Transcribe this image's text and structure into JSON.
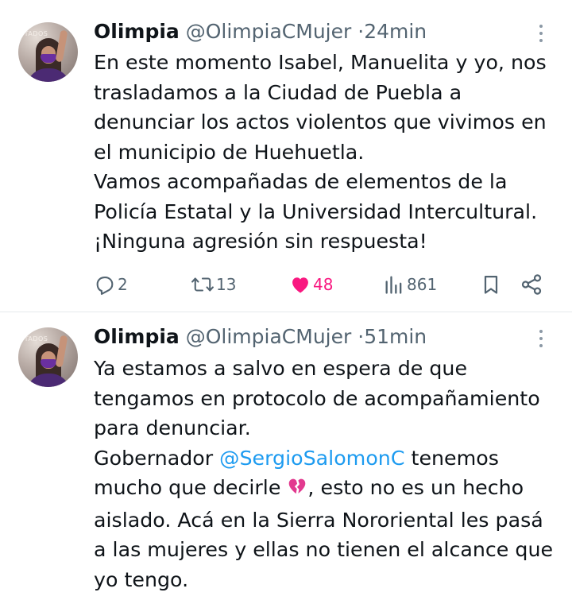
{
  "tweets": [
    {
      "display_name": "Olimpia",
      "handle": "@OlimpiaCMujer",
      "dot": "·",
      "time": "24min",
      "avatar_sign": "STADOS",
      "lines": [
        "En este momento Isabel, Manuelita y yo, nos",
        "trasladamos a la Ciudad de Puebla a",
        "denunciar los actos violentos que vivimos en",
        "el municipio de Huehuetla.",
        "Vamos acompañadas de elementos de la",
        "Policía Estatal y la Universidad Intercultural.",
        "¡Ninguna agresión sin respuesta!"
      ],
      "actions": {
        "replies": "2",
        "reposts": "13",
        "likes": "48",
        "views": "861"
      },
      "icons": {
        "reply": "reply-icon",
        "repost": "repost-icon",
        "like": "heart-filled-icon",
        "views": "views-icon",
        "bookmark": "bookmark-icon",
        "share": "share-icon",
        "more": "more-vertical-icon"
      }
    },
    {
      "display_name": "Olimpia",
      "handle": "@OlimpiaCMujer",
      "dot": "·",
      "time": "51min",
      "avatar_sign": "STADOS",
      "lines": [
        "Ya estamos a salvo en espera de que",
        "tengamos en protocolo de acompañamiento",
        "para denunciar."
      ],
      "line4": {
        "prefix": "Gobernador ",
        "mention": "@SergioSalomonC",
        "suffix": " tenemos"
      },
      "line5": {
        "prefix": "mucho que decirle ",
        "emoji": "broken-heart-icon",
        "suffix": ", esto no es un hecho"
      },
      "lines_end": [
        "aislado. Acá en la Sierra Nororiental les pasá",
        "a las mujeres y ellas no tienen el alcance que",
        "yo tengo."
      ]
    }
  ],
  "colors": {
    "text": "#0f1419",
    "secondary": "#536471",
    "mention": "#1d9bf0",
    "like": "#f91880",
    "broken_heart": "#e23a8f"
  }
}
